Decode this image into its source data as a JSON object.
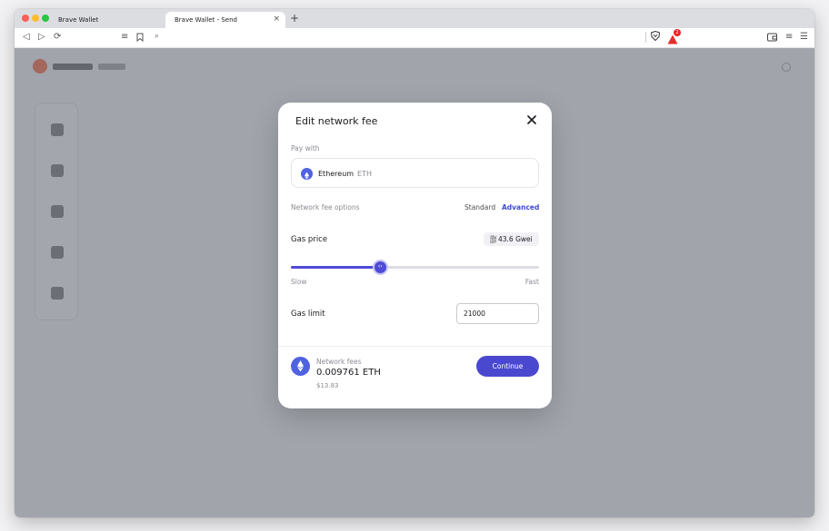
{
  "browser": {
    "tabs": [
      {
        "title": "Brave Wallet"
      },
      {
        "title": "Brave Wallet - Send"
      }
    ],
    "alert_count": "2"
  },
  "modal": {
    "title": "Edit network fee",
    "pay_with_label": "Pay with",
    "asset": {
      "name": "Ethereum",
      "symbol": "ETH"
    },
    "fee_options_label": "Network fee options",
    "option_standard": "Standard",
    "option_advanced": "Advanced",
    "gas_price_label": "Gas price",
    "gas_price_value": "43.6 Gwei",
    "slider": {
      "min_label": "Slow",
      "max_label": "Fast",
      "level": 0.36
    },
    "gas_limit_label": "Gas limit",
    "gas_limit_value": "21000",
    "network_fees_label": "Network fees",
    "network_fees_amount": "0.009761 ETH",
    "network_fees_usd": "$13.83",
    "continue_label": "Continue"
  },
  "colors": {
    "accent": "#4a48cf",
    "eth": "#4f62e0",
    "advanced_link": "#3f4ad3"
  }
}
